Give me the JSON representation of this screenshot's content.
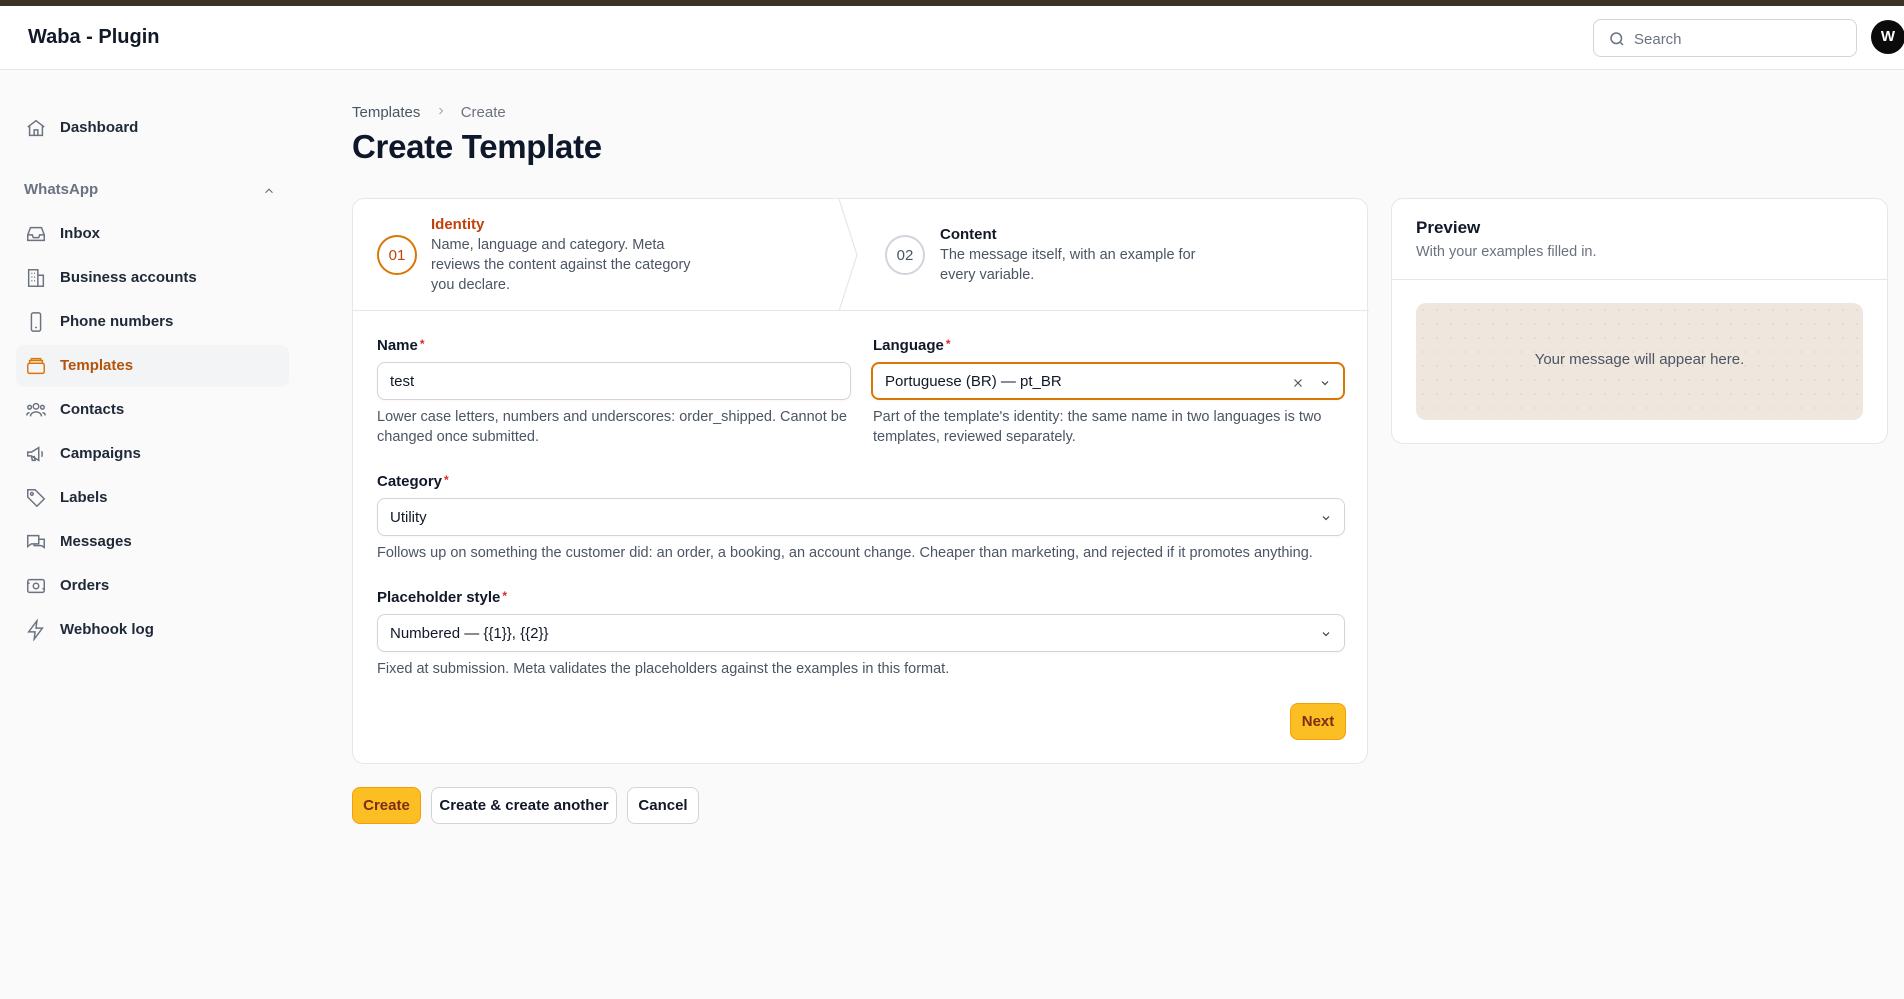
{
  "app": {
    "title": "Waba - Plugin",
    "avatar_initial": "W"
  },
  "search": {
    "placeholder": "Search",
    "value": ""
  },
  "sidebar": {
    "dashboard": "Dashboard",
    "group_label": "WhatsApp",
    "items": [
      {
        "label": "Inbox",
        "icon": "inbox-icon"
      },
      {
        "label": "Business accounts",
        "icon": "building-icon"
      },
      {
        "label": "Phone numbers",
        "icon": "phone-icon"
      },
      {
        "label": "Templates",
        "icon": "templates-icon",
        "active": true
      },
      {
        "label": "Contacts",
        "icon": "users-icon"
      },
      {
        "label": "Campaigns",
        "icon": "megaphone-icon"
      },
      {
        "label": "Labels",
        "icon": "tag-icon"
      },
      {
        "label": "Messages",
        "icon": "chat-bubbles-icon"
      },
      {
        "label": "Orders",
        "icon": "receipt-icon"
      },
      {
        "label": "Webhook log",
        "icon": "bolt-icon"
      }
    ]
  },
  "breadcrumb": {
    "parent": "Templates",
    "current": "Create"
  },
  "page": {
    "title": "Create Template"
  },
  "steps": [
    {
      "number": "01",
      "title": "Identity",
      "description": "Name, language and category. Meta reviews the content against the category you declare."
    },
    {
      "number": "02",
      "title": "Content",
      "description": "The message itself, with an example for every variable."
    }
  ],
  "form": {
    "name": {
      "label": "Name",
      "value": "test",
      "hint": "Lower case letters, numbers and underscores: order_shipped. Cannot be changed once submitted."
    },
    "language": {
      "label": "Language",
      "value": "Portuguese (BR) — pt_BR",
      "hint": "Part of the template's identity: the same name in two languages is two templates, reviewed separately."
    },
    "category": {
      "label": "Category",
      "value": "Utility",
      "hint": "Follows up on something the customer did: an order, a booking, an account change. Cheaper than marketing, and rejected if it promotes anything."
    },
    "placeholder_style": {
      "label": "Placeholder style",
      "value": "Numbered — {{1}}, {{2}}",
      "hint": "Fixed at submission. Meta validates the placeholders against the examples in this format."
    },
    "required_mark": "*",
    "next_label": "Next"
  },
  "actions": {
    "create": "Create",
    "create_another": "Create & create another",
    "cancel": "Cancel"
  },
  "preview": {
    "title": "Preview",
    "subtitle": "With your examples filled in.",
    "empty": "Your message will appear here."
  },
  "colors": {
    "accent": "#fbbf24",
    "active_text": "#b45309",
    "step_active": "#d97706",
    "preview_bg": "#efe6dd"
  }
}
